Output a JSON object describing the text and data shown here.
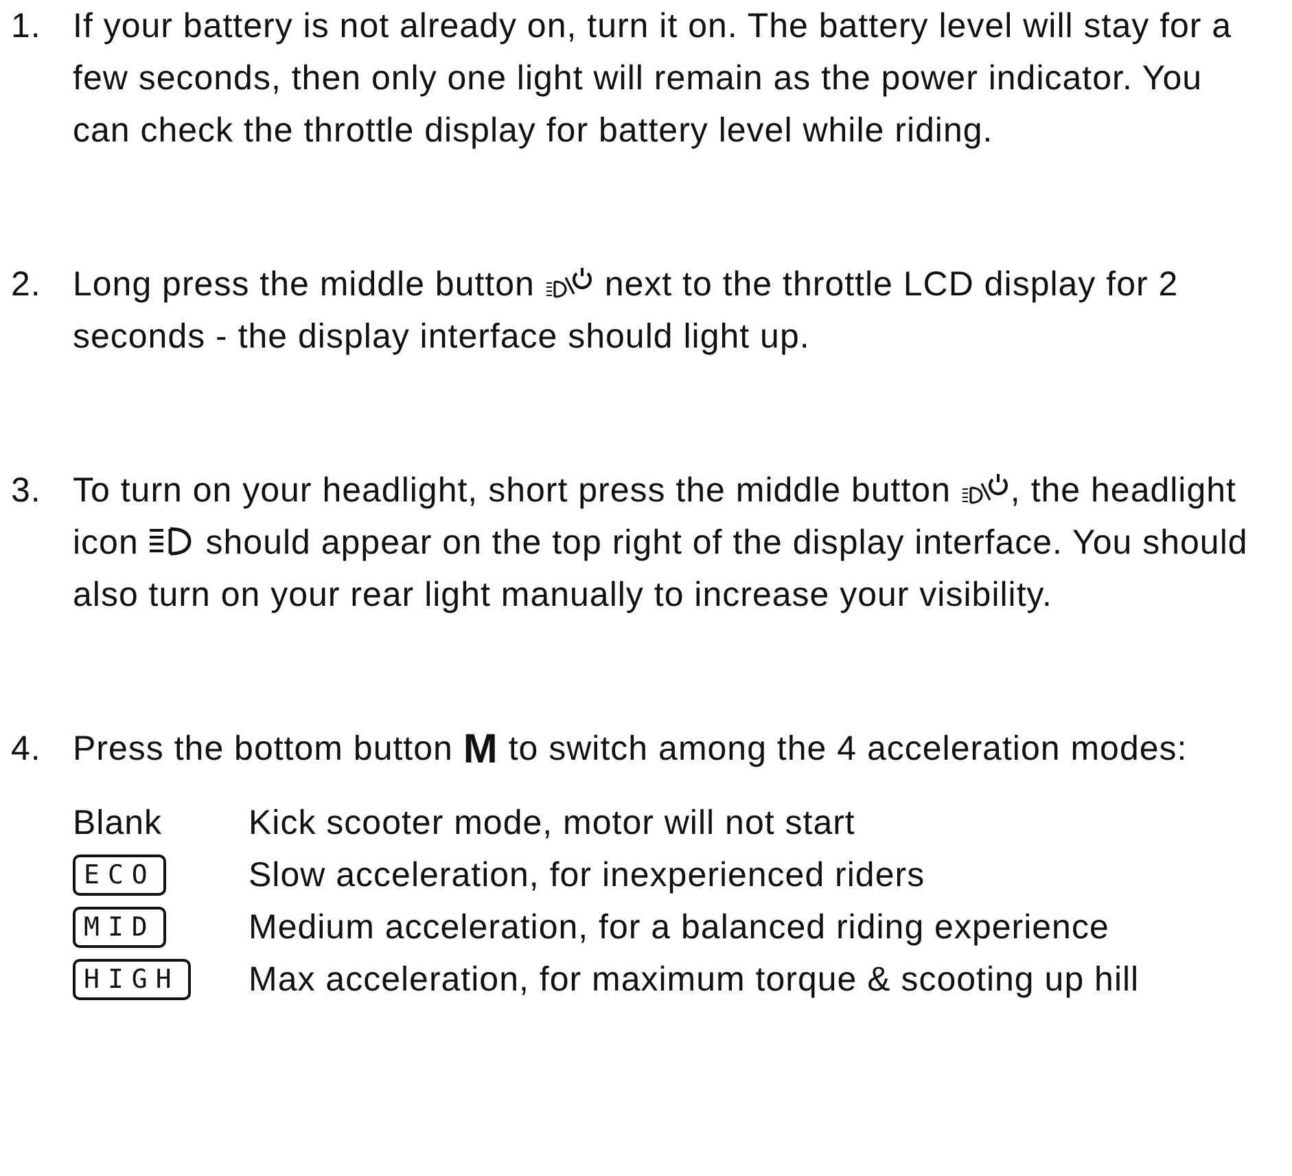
{
  "steps": [
    {
      "number": "1.",
      "parts": [
        {
          "kind": "text",
          "text": "If your battery is not already on, turn it on. The battery level will stay for a few seconds, then only one light will remain as the power indicator. You can check the throttle display for battery level while riding."
        }
      ]
    },
    {
      "number": "2.",
      "parts": [
        {
          "kind": "text",
          "text": "Long press the middle button "
        },
        {
          "kind": "powerlight"
        },
        {
          "kind": "text",
          "text": " next to the throttle LCD display for 2 seconds - the display interface should light up."
        }
      ]
    },
    {
      "number": "3.",
      "parts": [
        {
          "kind": "text",
          "text": "To turn on your headlight, short press the middle button  "
        },
        {
          "kind": "powerlight"
        },
        {
          "kind": "text",
          "text": ", the headlight icon "
        },
        {
          "kind": "headlight"
        },
        {
          "kind": "text",
          "text": " should appear on the top right of the display interface. You should also turn on your rear light manually to increase your visibility."
        }
      ]
    },
    {
      "number": "4.",
      "parts": [
        {
          "kind": "text",
          "text": "Press the bottom button "
        },
        {
          "kind": "key",
          "text": "M"
        },
        {
          "kind": "text",
          "text": " to switch among the 4 acceleration modes:"
        }
      ],
      "modes": [
        {
          "kind": "plain",
          "label": "Blank",
          "description": "Kick scooter mode, motor will not start"
        },
        {
          "kind": "lcd",
          "label": "ECO",
          "description": "Slow acceleration, for inexperienced riders"
        },
        {
          "kind": "lcd",
          "label": "MID",
          "description": "Medium acceleration, for a balanced riding experience"
        },
        {
          "kind": "lcd",
          "label": "HIGH",
          "description": "Max acceleration, for maximum torque & scooting up hill"
        }
      ]
    }
  ]
}
